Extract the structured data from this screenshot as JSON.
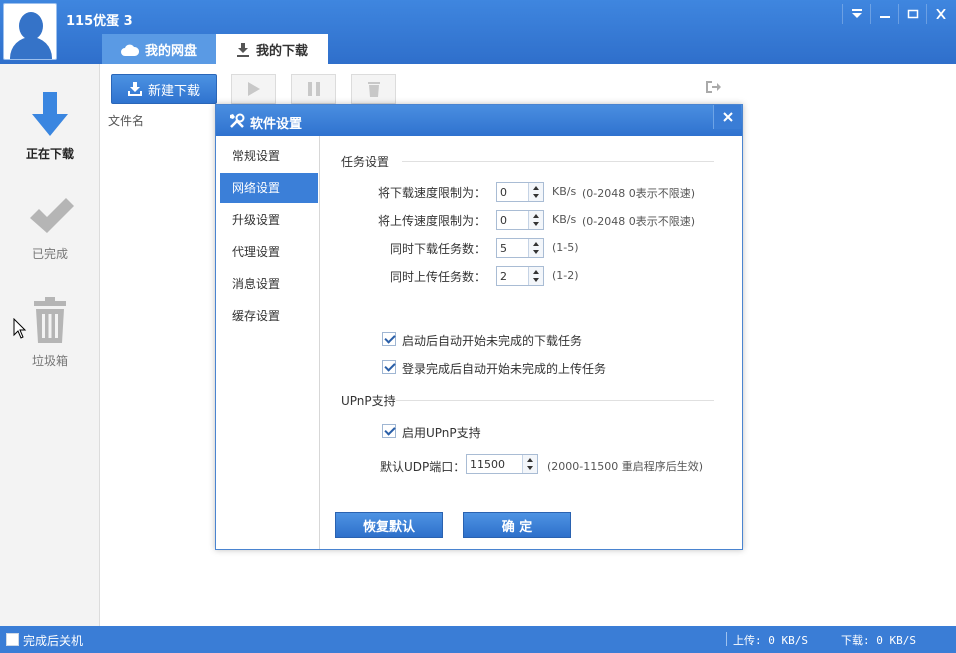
{
  "titlebar": {
    "username": "115优蛋 3",
    "tabs": [
      {
        "label": "我的网盘",
        "icon": "cloud-icon"
      },
      {
        "label": "我的下载",
        "icon": "download-icon"
      }
    ]
  },
  "sidebar": {
    "items": [
      {
        "label": "正在下载",
        "icon": "download-arrow-icon"
      },
      {
        "label": "已完成",
        "icon": "check-icon"
      },
      {
        "label": "垃圾箱",
        "icon": "trash-icon"
      }
    ]
  },
  "toolbar": {
    "new_download": "新建下载"
  },
  "list": {
    "column_filename": "文件名"
  },
  "statusbar": {
    "shutdown_label": "完成后关机",
    "upload": "上传: 0 KB/S",
    "download": "下载: 0 KB/S"
  },
  "dialog": {
    "title": "软件设置",
    "nav": [
      "常规设置",
      "网络设置",
      "升级设置",
      "代理设置",
      "消息设置",
      "缓存设置"
    ],
    "task_section": "任务设置",
    "fields": [
      {
        "label": "将下载速度限制为：",
        "value": "0",
        "unit": "KB/s",
        "hint": "(0-2048   0表示不限速)"
      },
      {
        "label": "将上传速度限制为：",
        "value": "0",
        "unit": "KB/s",
        "hint": "(0-2048   0表示不限速)"
      },
      {
        "label": "同时下载任务数：",
        "value": "5",
        "unit": "",
        "hint": "(1-5)"
      },
      {
        "label": "同时上传任务数：",
        "value": "2",
        "unit": "",
        "hint": "(1-2)"
      }
    ],
    "checkboxes": [
      {
        "label": "启动后自动开始未完成的下载任务",
        "checked": true
      },
      {
        "label": "登录完成后自动开始未完成的上传任务",
        "checked": true
      }
    ],
    "upnp_section": "UPnP支持",
    "upnp_checkbox": {
      "label": "启用UPnP支持",
      "checked": true
    },
    "udp_label": "默认UDP端口：",
    "udp_value": "11500",
    "udp_hint": "(2000-11500  重启程序后生效)",
    "btn_restore": "恢复默认",
    "btn_ok": "确  定"
  }
}
